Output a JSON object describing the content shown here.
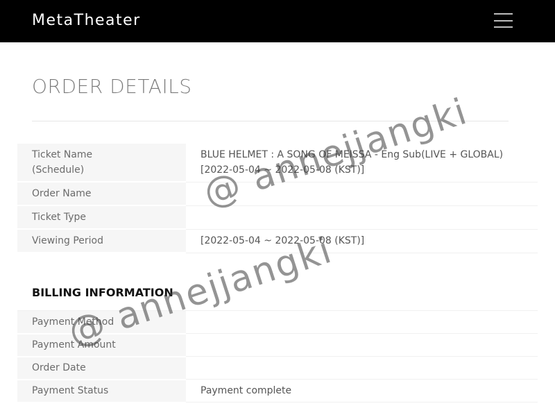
{
  "header": {
    "brand": "MetaTheater",
    "menu_icon": "hamburger-menu-icon"
  },
  "page": {
    "title": "ORDER DETAILS"
  },
  "order": {
    "ticket_name_label_line1": "Ticket Name",
    "ticket_name_label_line2": "(Schedule)",
    "ticket_name_value_line1": "BLUE HELMET : A SONG OF MEISSA - Eng Sub(LIVE + GLOBAL)",
    "ticket_name_value_line2": "[2022-05-04 ~ 2022-05-08 (KST)]",
    "order_name_label": "Order Name",
    "order_name_value": "",
    "ticket_type_label": "Ticket Type",
    "ticket_type_value": "",
    "viewing_period_label": "Viewing Period",
    "viewing_period_value": "[2022-05-04 ~ 2022-05-08 (KST)]"
  },
  "billing": {
    "section_title": "BILLING INFORMATION",
    "payment_method_label": "Payment Method",
    "payment_method_value": "",
    "payment_amount_label": "Payment Amount",
    "payment_amount_value": "",
    "order_date_label": "Order Date",
    "order_date_value": "",
    "payment_status_label": "Payment Status",
    "payment_status_value": "Payment complete"
  },
  "watermark": {
    "text_1": "@ annejjangki",
    "text_2": "@ annejjangki"
  }
}
